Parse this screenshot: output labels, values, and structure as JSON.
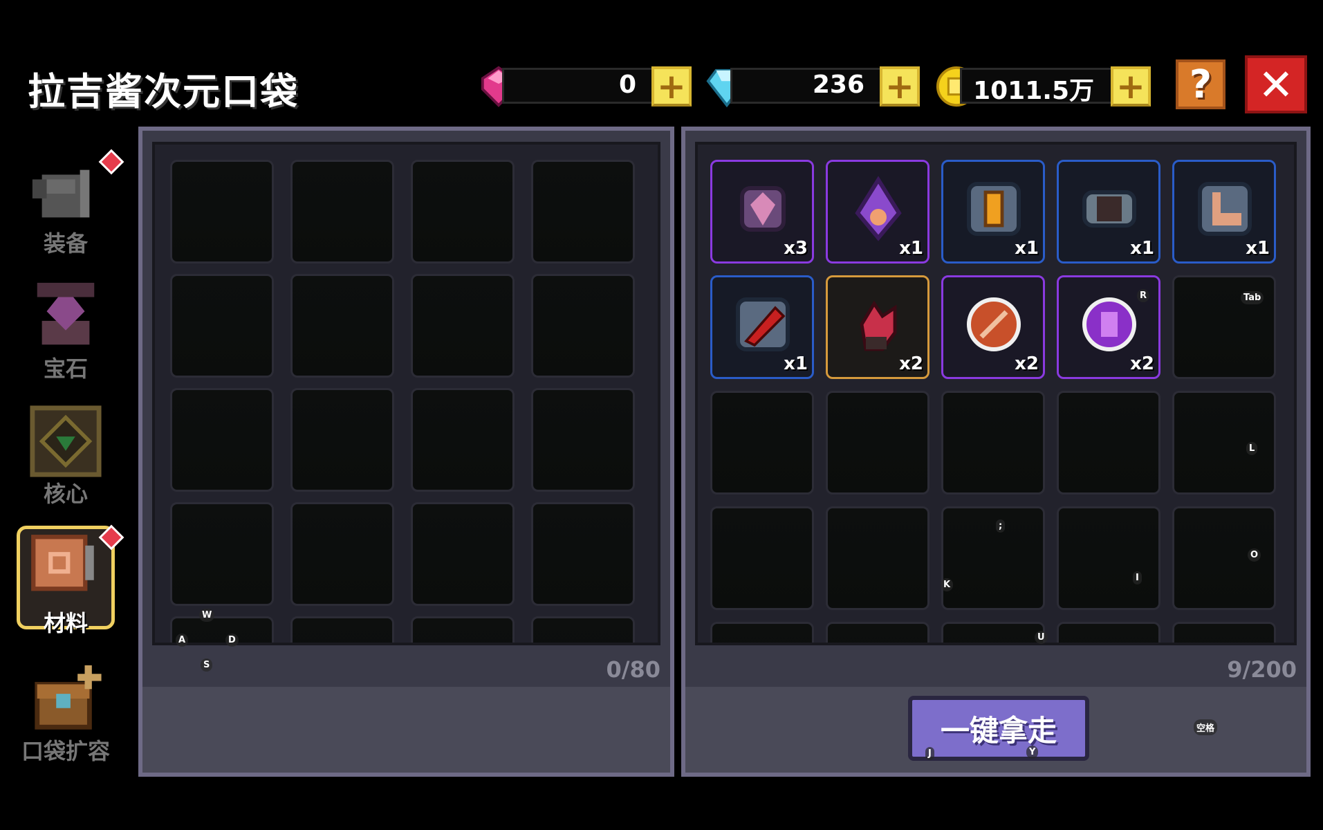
{
  "title": "拉吉酱次元口袋",
  "currencies": {
    "pink_gem": "0",
    "diamond": "236",
    "gold": "1011.5万"
  },
  "buttons": {
    "plus": "+",
    "help": "?",
    "close": "✕",
    "take_all": "一键拿走"
  },
  "sidebar": [
    {
      "label": "装备",
      "icon": "armor-icon",
      "badge": true
    },
    {
      "label": "宝石",
      "icon": "gem-altar-icon",
      "badge": false
    },
    {
      "label": "核心",
      "icon": "core-icon",
      "badge": false
    },
    {
      "label": "材料",
      "icon": "material-icon",
      "badge": true,
      "active": true
    },
    {
      "label": "口袋扩容",
      "icon": "chest-icon",
      "badge": false
    }
  ],
  "left_panel": {
    "count": "0/80"
  },
  "right_panel": {
    "count": "9/200",
    "items": [
      {
        "qty": "x3",
        "rarity": "purple",
        "icon": "pink-crystal-icon"
      },
      {
        "qty": "x1",
        "rarity": "purple",
        "icon": "purple-drop-icon"
      },
      {
        "qty": "x1",
        "rarity": "blue",
        "icon": "lantern-icon"
      },
      {
        "qty": "x1",
        "rarity": "blue",
        "icon": "metal-pipe-icon"
      },
      {
        "qty": "x1",
        "rarity": "blue",
        "icon": "boot-icon"
      },
      {
        "qty": "x1",
        "rarity": "blue",
        "icon": "red-bullet-icon"
      },
      {
        "qty": "x2",
        "rarity": "orange",
        "icon": "red-crystal-icon"
      },
      {
        "qty": "x2",
        "rarity": "purple",
        "icon": "red-orb-icon"
      },
      {
        "qty": "x2",
        "rarity": "purple",
        "icon": "purple-orb-icon"
      }
    ]
  },
  "key_hints": {
    "w": "W",
    "a": "A",
    "s": "S",
    "d": "D",
    "r": "R",
    "tab": "Tab",
    "l": "L",
    "semicolon": ";",
    "k": "K",
    "i": "I",
    "o": "O",
    "u": "U",
    "space": "空格",
    "j": "J",
    "y": "Y"
  },
  "colors": {
    "purple_rarity": "#8a3ae0",
    "blue_rarity": "#2a5cc8",
    "orange_rarity": "#d69a3c",
    "close_red": "#d42525",
    "help_orange": "#d97a2a",
    "take_button": "#7d6ecb"
  }
}
